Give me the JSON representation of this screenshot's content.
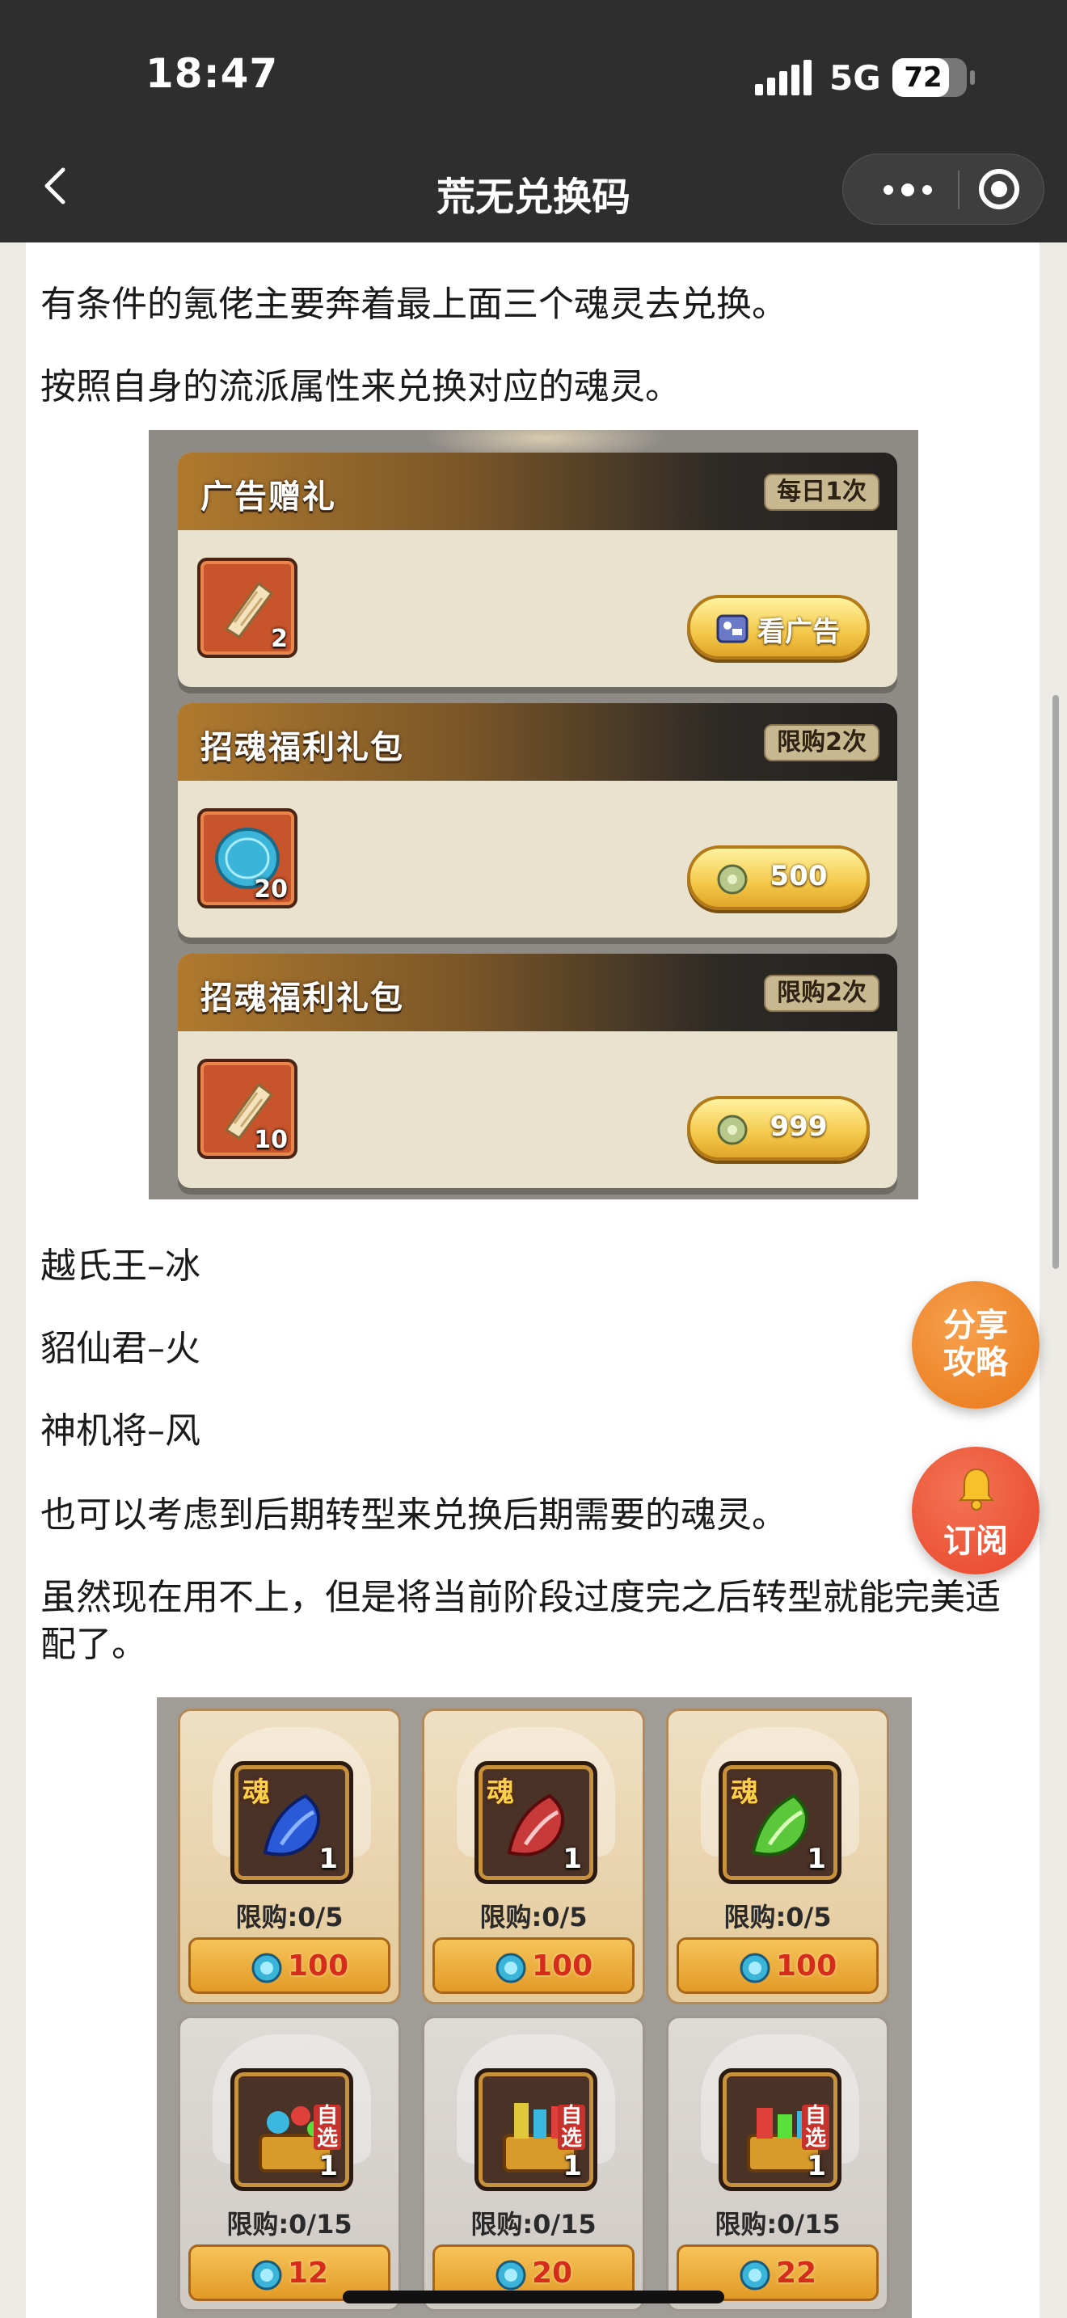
{
  "status_bar": {
    "time": "18:47",
    "network": "5G",
    "battery": "72"
  },
  "nav": {
    "title": "荒无兑换码",
    "back_icon": "chevron-left-icon",
    "more_icon": "more-dots-icon",
    "close_icon": "target-circle-icon"
  },
  "article": {
    "paragraphs": [
      "有条件的氪佬主要奔着最上面三个魂灵去兑换。",
      "按照自身的流派属性来兑换对应的魂灵。",
      "越氏王–冰",
      "貂仙君–火",
      "神机将–风",
      "也可以考虑到后期转型来兑换后期需要的魂灵。",
      "虽然现在用不上，但是将当前阶段过度完之后转型就能完美适配了。"
    ]
  },
  "image1": {
    "panels": [
      {
        "title": "广告赠礼",
        "limit": "每日1次",
        "item_qty": "2",
        "item_icon": "scroll-icon",
        "button": "看广告",
        "button_icon": "video-icon"
      },
      {
        "title": "招魂福利礼包",
        "limit": "限购2次",
        "item_qty": "20",
        "item_icon": "soul-coin-icon",
        "button": "500",
        "button_icon": "jade-coin-icon"
      },
      {
        "title": "招魂福利礼包",
        "limit": "限购2次",
        "item_qty": "10",
        "item_icon": "scroll-icon",
        "button": "999",
        "button_icon": "jade-coin-icon"
      }
    ]
  },
  "image2": {
    "cards": [
      {
        "tag": "魂",
        "qty": "1",
        "limit": "限购:0/5",
        "price": "100",
        "icon": "blue-soul-icon",
        "color": "#2a5ad8"
      },
      {
        "tag": "魂",
        "qty": "1",
        "limit": "限购:0/5",
        "price": "100",
        "icon": "red-soul-icon",
        "color": "#c83a3a"
      },
      {
        "tag": "魂",
        "qty": "1",
        "limit": "限购:0/5",
        "price": "100",
        "icon": "green-soul-icon",
        "color": "#5ac83a"
      },
      {
        "tag": "自选",
        "qty": "1",
        "limit": "限购:0/15",
        "price": "12",
        "icon": "gem-chest-icon",
        "color": "#3ab8e0"
      },
      {
        "tag": "自选",
        "qty": "1",
        "limit": "限购:0/15",
        "price": "20",
        "icon": "gem-chest-icon",
        "color": "#e0c83a"
      },
      {
        "tag": "自选",
        "qty": "1",
        "limit": "限购:0/15",
        "price": "22",
        "icon": "gem-chest-icon",
        "color": "#3ae07a"
      }
    ]
  },
  "fab": {
    "share": "分享攻略",
    "share_line1": "分享",
    "share_line2": "攻略",
    "subscribe": "订阅"
  },
  "colors": {
    "accent_orange": "#ea7618",
    "accent_red": "#e8442a",
    "nav_bg": "#2e2e2e"
  }
}
